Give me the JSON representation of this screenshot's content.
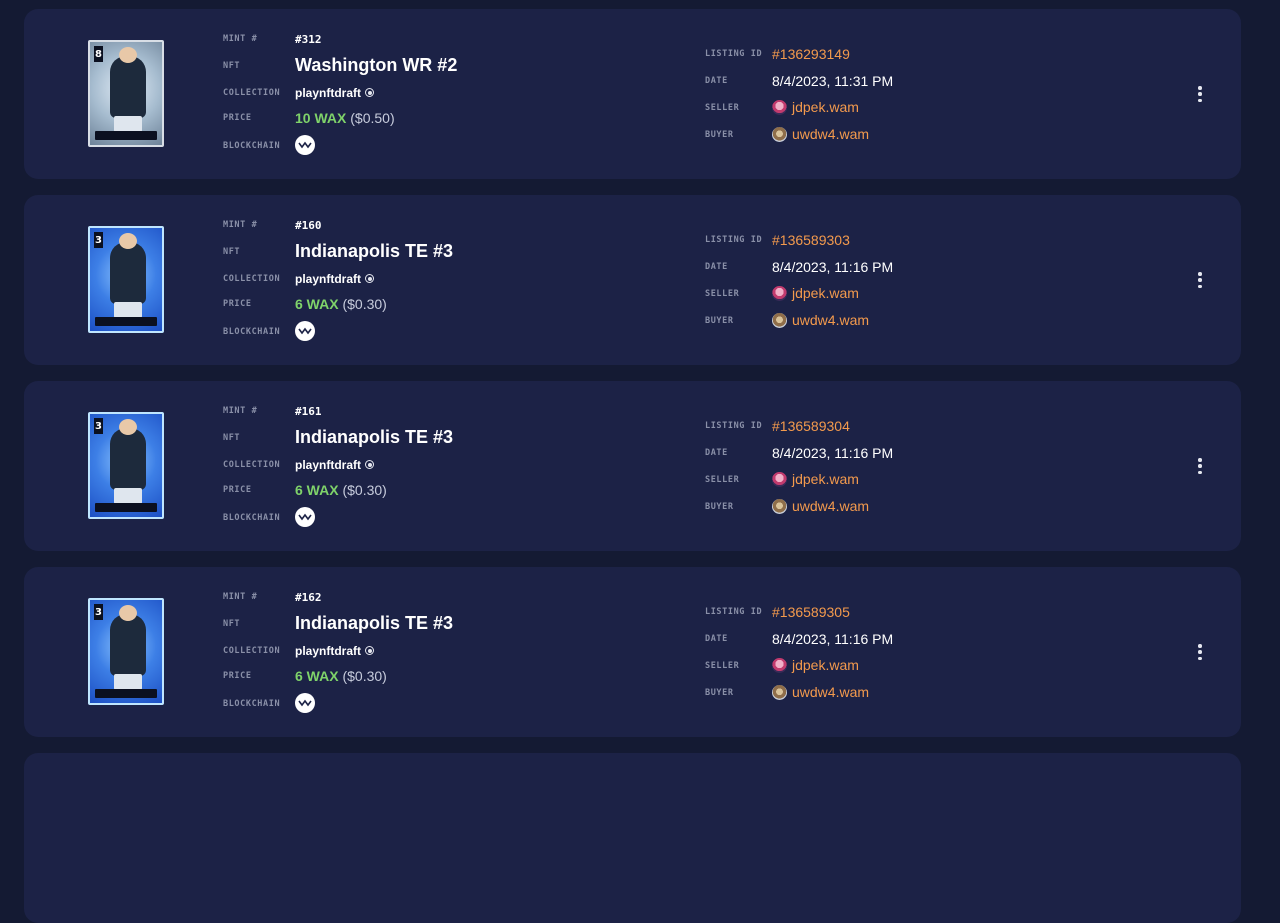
{
  "labels": {
    "mint": "MINT #",
    "nft": "NFT",
    "collection": "COLLECTION",
    "price": "PRICE",
    "blockchain": "BLOCKCHAIN",
    "listing_id": "LISTING ID",
    "date": "DATE",
    "seller": "SELLER",
    "buyer": "BUYER"
  },
  "sales": [
    {
      "mint": "#312",
      "nft": "Washington WR #2",
      "collection": "playnftdraft",
      "price_wax": "10 WAX",
      "price_usd": "($0.50)",
      "blockchain_icon": "wax-icon",
      "listing_id": "#136293149",
      "date": "8/4/2023, 11:31 PM",
      "seller": "jdpek.wam",
      "buyer": "uwdw4.wam",
      "card_number": "8"
    },
    {
      "mint": "#160",
      "nft": "Indianapolis TE #3",
      "collection": "playnftdraft",
      "price_wax": "6 WAX",
      "price_usd": "($0.30)",
      "blockchain_icon": "wax-icon",
      "listing_id": "#136589303",
      "date": "8/4/2023, 11:16 PM",
      "seller": "jdpek.wam",
      "buyer": "uwdw4.wam",
      "card_number": "3"
    },
    {
      "mint": "#161",
      "nft": "Indianapolis TE #3",
      "collection": "playnftdraft",
      "price_wax": "6 WAX",
      "price_usd": "($0.30)",
      "blockchain_icon": "wax-icon",
      "listing_id": "#136589304",
      "date": "8/4/2023, 11:16 PM",
      "seller": "jdpek.wam",
      "buyer": "uwdw4.wam",
      "card_number": "3"
    },
    {
      "mint": "#162",
      "nft": "Indianapolis TE #3",
      "collection": "playnftdraft",
      "price_wax": "6 WAX",
      "price_usd": "($0.30)",
      "blockchain_icon": "wax-icon",
      "listing_id": "#136589305",
      "date": "8/4/2023, 11:16 PM",
      "seller": "jdpek.wam",
      "buyer": "uwdw4.wam",
      "card_number": "3"
    }
  ],
  "colors": {
    "background": "#141a33",
    "card": "#1c2246",
    "accent_orange": "#f39a4d",
    "wax_green": "#7fd36a"
  }
}
